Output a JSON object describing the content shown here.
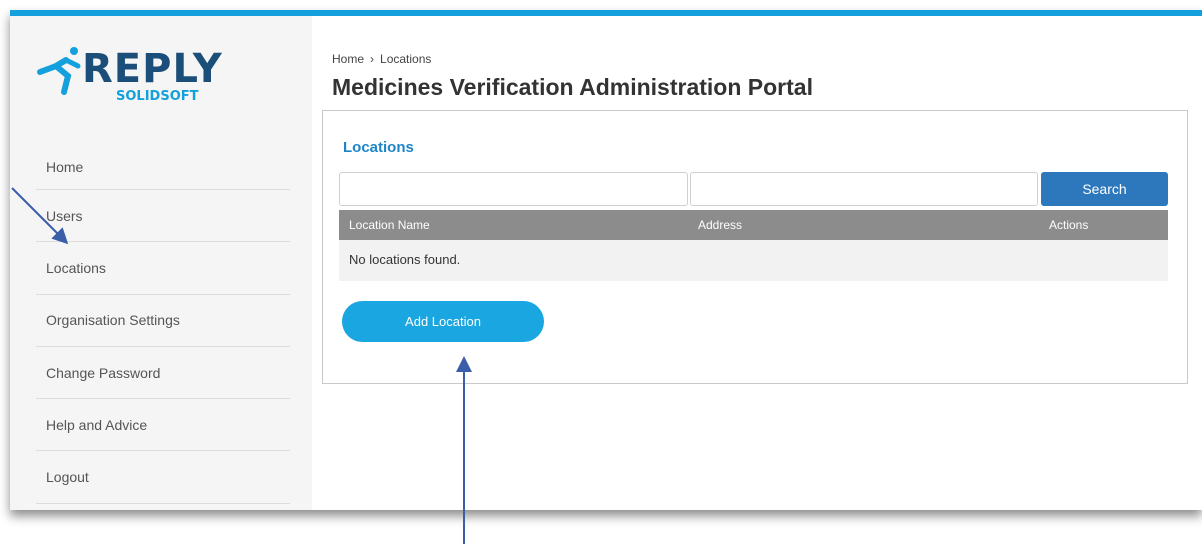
{
  "brand": {
    "name": "REPLY",
    "sub": "SOLIDSOFT",
    "primary_color": "#1c4e7a",
    "accent_color": "#14a0dc",
    "icon": "running-figure-logo"
  },
  "sidebar": {
    "items": [
      {
        "label": "Home"
      },
      {
        "label": "Users"
      },
      {
        "label": "Locations"
      },
      {
        "label": "Organisation Settings"
      },
      {
        "label": "Change Password"
      },
      {
        "label": "Help and Advice"
      },
      {
        "label": "Logout"
      }
    ]
  },
  "breadcrumb": {
    "home": "Home",
    "separator": "›",
    "current": "Locations"
  },
  "page_title": "Medicines Verification Administration Portal",
  "panel": {
    "title": "Locations",
    "search": {
      "name_value": "",
      "address_value": "",
      "button_label": "Search"
    },
    "table": {
      "columns": [
        "Location Name",
        "Address",
        "Actions"
      ],
      "empty_message": "No locations found."
    },
    "add_button_label": "Add Location"
  }
}
